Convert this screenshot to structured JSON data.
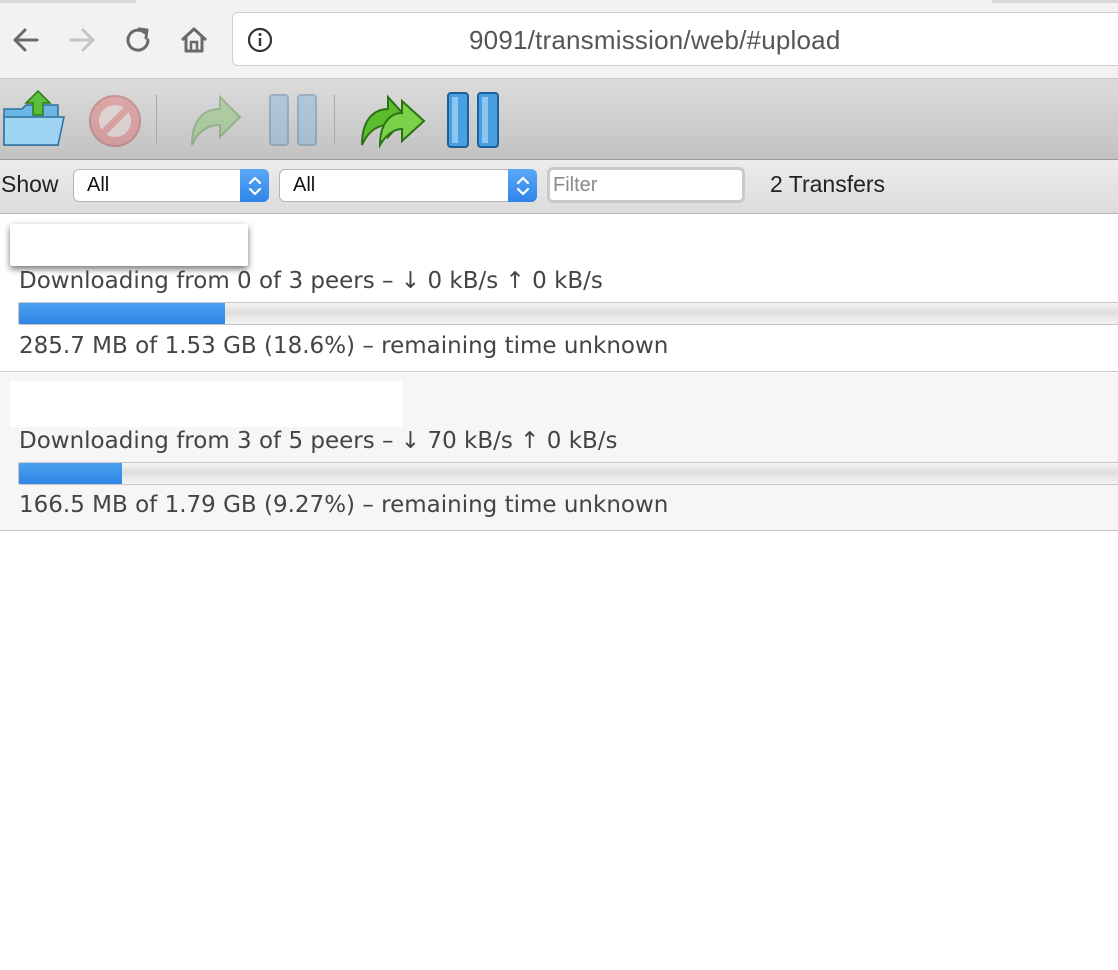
{
  "browser": {
    "url": "9091/transmission/web/#upload",
    "icons": [
      "back-arrow-icon",
      "forward-arrow-icon",
      "reload-icon",
      "home-icon",
      "info-icon"
    ]
  },
  "toolbar": {
    "buttons": [
      {
        "name": "open-torrent",
        "icon": "folder-upload-icon",
        "enabled": true
      },
      {
        "name": "remove-torrent",
        "icon": "no-entry-icon",
        "enabled": false
      },
      {
        "name": "resume-torrent",
        "icon": "green-arrow-icon",
        "enabled": false
      },
      {
        "name": "pause-torrent",
        "icon": "pause-icon",
        "enabled": false
      },
      {
        "name": "resume-all",
        "icon": "double-green-arrow-icon",
        "enabled": true
      },
      {
        "name": "pause-all",
        "icon": "pause-all-icon",
        "enabled": true
      }
    ]
  },
  "filterbar": {
    "show_label": "Show",
    "state_select": "All",
    "tracker_select": "All",
    "filter_placeholder": "Filter",
    "transfer_count": "2 Transfers",
    "accent": "#3a8ef0"
  },
  "torrents": [
    {
      "peers": "Downloading from 0 of 3 peers – ↓ 0 kB/s ↑ 0 kB/s",
      "progress_fraction": 0.186,
      "size": "285.7 MB of 1.53 GB (18.6%) – remaining time unknown"
    },
    {
      "peers": "Downloading from 3 of 5 peers – ↓ 70 kB/s ↑ 0 kB/s",
      "progress_fraction": 0.0927,
      "size": "166.5 MB of 1.79 GB (9.27%) – remaining time unknown"
    }
  ]
}
